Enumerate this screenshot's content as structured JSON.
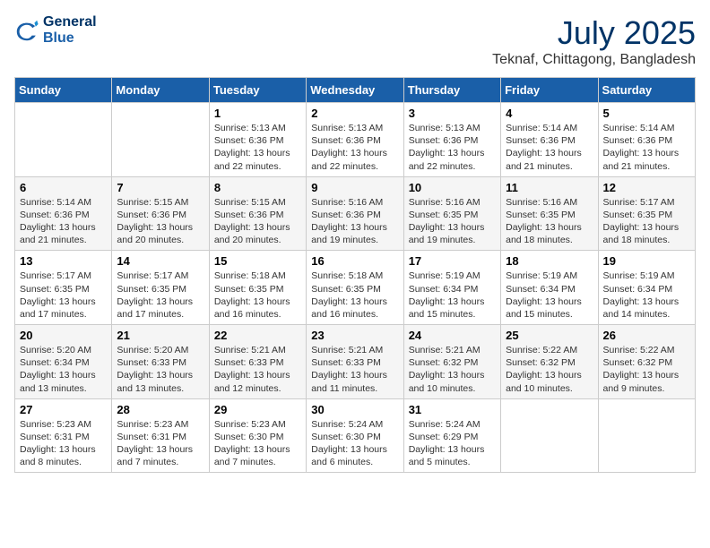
{
  "header": {
    "logo_line1": "General",
    "logo_line2": "Blue",
    "month_year": "July 2025",
    "location": "Teknaf, Chittagong, Bangladesh"
  },
  "weekdays": [
    "Sunday",
    "Monday",
    "Tuesday",
    "Wednesday",
    "Thursday",
    "Friday",
    "Saturday"
  ],
  "weeks": [
    [
      {
        "day": "",
        "lines": []
      },
      {
        "day": "",
        "lines": []
      },
      {
        "day": "1",
        "lines": [
          "Sunrise: 5:13 AM",
          "Sunset: 6:36 PM",
          "Daylight: 13 hours",
          "and 22 minutes."
        ]
      },
      {
        "day": "2",
        "lines": [
          "Sunrise: 5:13 AM",
          "Sunset: 6:36 PM",
          "Daylight: 13 hours",
          "and 22 minutes."
        ]
      },
      {
        "day": "3",
        "lines": [
          "Sunrise: 5:13 AM",
          "Sunset: 6:36 PM",
          "Daylight: 13 hours",
          "and 22 minutes."
        ]
      },
      {
        "day": "4",
        "lines": [
          "Sunrise: 5:14 AM",
          "Sunset: 6:36 PM",
          "Daylight: 13 hours",
          "and 21 minutes."
        ]
      },
      {
        "day": "5",
        "lines": [
          "Sunrise: 5:14 AM",
          "Sunset: 6:36 PM",
          "Daylight: 13 hours",
          "and 21 minutes."
        ]
      }
    ],
    [
      {
        "day": "6",
        "lines": [
          "Sunrise: 5:14 AM",
          "Sunset: 6:36 PM",
          "Daylight: 13 hours",
          "and 21 minutes."
        ]
      },
      {
        "day": "7",
        "lines": [
          "Sunrise: 5:15 AM",
          "Sunset: 6:36 PM",
          "Daylight: 13 hours",
          "and 20 minutes."
        ]
      },
      {
        "day": "8",
        "lines": [
          "Sunrise: 5:15 AM",
          "Sunset: 6:36 PM",
          "Daylight: 13 hours",
          "and 20 minutes."
        ]
      },
      {
        "day": "9",
        "lines": [
          "Sunrise: 5:16 AM",
          "Sunset: 6:36 PM",
          "Daylight: 13 hours",
          "and 19 minutes."
        ]
      },
      {
        "day": "10",
        "lines": [
          "Sunrise: 5:16 AM",
          "Sunset: 6:35 PM",
          "Daylight: 13 hours",
          "and 19 minutes."
        ]
      },
      {
        "day": "11",
        "lines": [
          "Sunrise: 5:16 AM",
          "Sunset: 6:35 PM",
          "Daylight: 13 hours",
          "and 18 minutes."
        ]
      },
      {
        "day": "12",
        "lines": [
          "Sunrise: 5:17 AM",
          "Sunset: 6:35 PM",
          "Daylight: 13 hours",
          "and 18 minutes."
        ]
      }
    ],
    [
      {
        "day": "13",
        "lines": [
          "Sunrise: 5:17 AM",
          "Sunset: 6:35 PM",
          "Daylight: 13 hours",
          "and 17 minutes."
        ]
      },
      {
        "day": "14",
        "lines": [
          "Sunrise: 5:17 AM",
          "Sunset: 6:35 PM",
          "Daylight: 13 hours",
          "and 17 minutes."
        ]
      },
      {
        "day": "15",
        "lines": [
          "Sunrise: 5:18 AM",
          "Sunset: 6:35 PM",
          "Daylight: 13 hours",
          "and 16 minutes."
        ]
      },
      {
        "day": "16",
        "lines": [
          "Sunrise: 5:18 AM",
          "Sunset: 6:35 PM",
          "Daylight: 13 hours",
          "and 16 minutes."
        ]
      },
      {
        "day": "17",
        "lines": [
          "Sunrise: 5:19 AM",
          "Sunset: 6:34 PM",
          "Daylight: 13 hours",
          "and 15 minutes."
        ]
      },
      {
        "day": "18",
        "lines": [
          "Sunrise: 5:19 AM",
          "Sunset: 6:34 PM",
          "Daylight: 13 hours",
          "and 15 minutes."
        ]
      },
      {
        "day": "19",
        "lines": [
          "Sunrise: 5:19 AM",
          "Sunset: 6:34 PM",
          "Daylight: 13 hours",
          "and 14 minutes."
        ]
      }
    ],
    [
      {
        "day": "20",
        "lines": [
          "Sunrise: 5:20 AM",
          "Sunset: 6:34 PM",
          "Daylight: 13 hours",
          "and 13 minutes."
        ]
      },
      {
        "day": "21",
        "lines": [
          "Sunrise: 5:20 AM",
          "Sunset: 6:33 PM",
          "Daylight: 13 hours",
          "and 13 minutes."
        ]
      },
      {
        "day": "22",
        "lines": [
          "Sunrise: 5:21 AM",
          "Sunset: 6:33 PM",
          "Daylight: 13 hours",
          "and 12 minutes."
        ]
      },
      {
        "day": "23",
        "lines": [
          "Sunrise: 5:21 AM",
          "Sunset: 6:33 PM",
          "Daylight: 13 hours",
          "and 11 minutes."
        ]
      },
      {
        "day": "24",
        "lines": [
          "Sunrise: 5:21 AM",
          "Sunset: 6:32 PM",
          "Daylight: 13 hours",
          "and 10 minutes."
        ]
      },
      {
        "day": "25",
        "lines": [
          "Sunrise: 5:22 AM",
          "Sunset: 6:32 PM",
          "Daylight: 13 hours",
          "and 10 minutes."
        ]
      },
      {
        "day": "26",
        "lines": [
          "Sunrise: 5:22 AM",
          "Sunset: 6:32 PM",
          "Daylight: 13 hours",
          "and 9 minutes."
        ]
      }
    ],
    [
      {
        "day": "27",
        "lines": [
          "Sunrise: 5:23 AM",
          "Sunset: 6:31 PM",
          "Daylight: 13 hours",
          "and 8 minutes."
        ]
      },
      {
        "day": "28",
        "lines": [
          "Sunrise: 5:23 AM",
          "Sunset: 6:31 PM",
          "Daylight: 13 hours",
          "and 7 minutes."
        ]
      },
      {
        "day": "29",
        "lines": [
          "Sunrise: 5:23 AM",
          "Sunset: 6:30 PM",
          "Daylight: 13 hours",
          "and 7 minutes."
        ]
      },
      {
        "day": "30",
        "lines": [
          "Sunrise: 5:24 AM",
          "Sunset: 6:30 PM",
          "Daylight: 13 hours",
          "and 6 minutes."
        ]
      },
      {
        "day": "31",
        "lines": [
          "Sunrise: 5:24 AM",
          "Sunset: 6:29 PM",
          "Daylight: 13 hours",
          "and 5 minutes."
        ]
      },
      {
        "day": "",
        "lines": []
      },
      {
        "day": "",
        "lines": []
      }
    ]
  ]
}
